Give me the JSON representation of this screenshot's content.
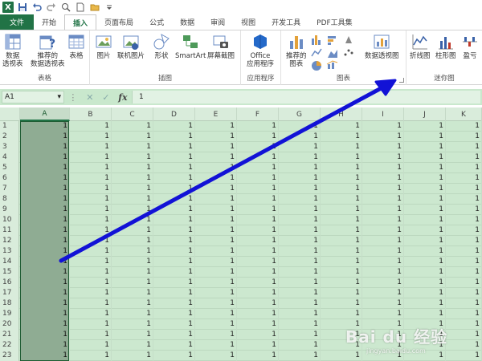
{
  "qat": {
    "icons": [
      "excel-logo",
      "save-icon",
      "undo-icon",
      "redo-icon",
      "preview-icon",
      "new-icon",
      "open-icon",
      "more-icon"
    ]
  },
  "tabs": [
    "文件",
    "开始",
    "插入",
    "页面布局",
    "公式",
    "数据",
    "审阅",
    "视图",
    "开发工具",
    "PDF工具集"
  ],
  "active_tab": "插入",
  "ribbon": {
    "tables": {
      "label": "表格",
      "buttons": [
        {
          "line1": "数据",
          "line2": "透视表"
        },
        {
          "line1": "推荐的",
          "line2": "数据透视表"
        },
        {
          "line1": "表格",
          "line2": ""
        }
      ]
    },
    "illustrations": {
      "label": "插图",
      "buttons": [
        {
          "line1": "图片"
        },
        {
          "line1": "联机图片"
        },
        {
          "line1": "形状"
        },
        {
          "line1": "SmartArt"
        },
        {
          "line1": "屏幕截图"
        }
      ]
    },
    "apps": {
      "label": "应用程序",
      "line1": "Office",
      "line2": "应用程序"
    },
    "charts": {
      "label": "图表",
      "recommended_line1": "推荐的",
      "recommended_line2": "图表",
      "pivot_chart": "数据透视图"
    },
    "sparklines": {
      "label": "迷你图",
      "buttons": [
        "折线图",
        "柱形图",
        "盈亏"
      ]
    }
  },
  "formula_bar": {
    "name_box": "A1",
    "fx": "fx",
    "value": "1"
  },
  "columns": [
    "A",
    "B",
    "C",
    "D",
    "E",
    "F",
    "G",
    "H",
    "I",
    "J",
    "K"
  ],
  "selected_column": "A",
  "row_numbers": [
    "1",
    "2",
    "3",
    "4",
    "5",
    "6",
    "7",
    "8",
    "9",
    "10",
    "11",
    "12",
    "13",
    "14",
    "15",
    "16",
    "17",
    "18",
    "19",
    "20",
    "21",
    "22",
    "23"
  ],
  "cell_value": "1",
  "colors": {
    "excel_green": "#217346",
    "arrow": "#1212d6",
    "grid_bg": "#cce8cf"
  },
  "watermark": {
    "main": "Bai du 经验",
    "sub": "jingyan.baidu.com"
  }
}
